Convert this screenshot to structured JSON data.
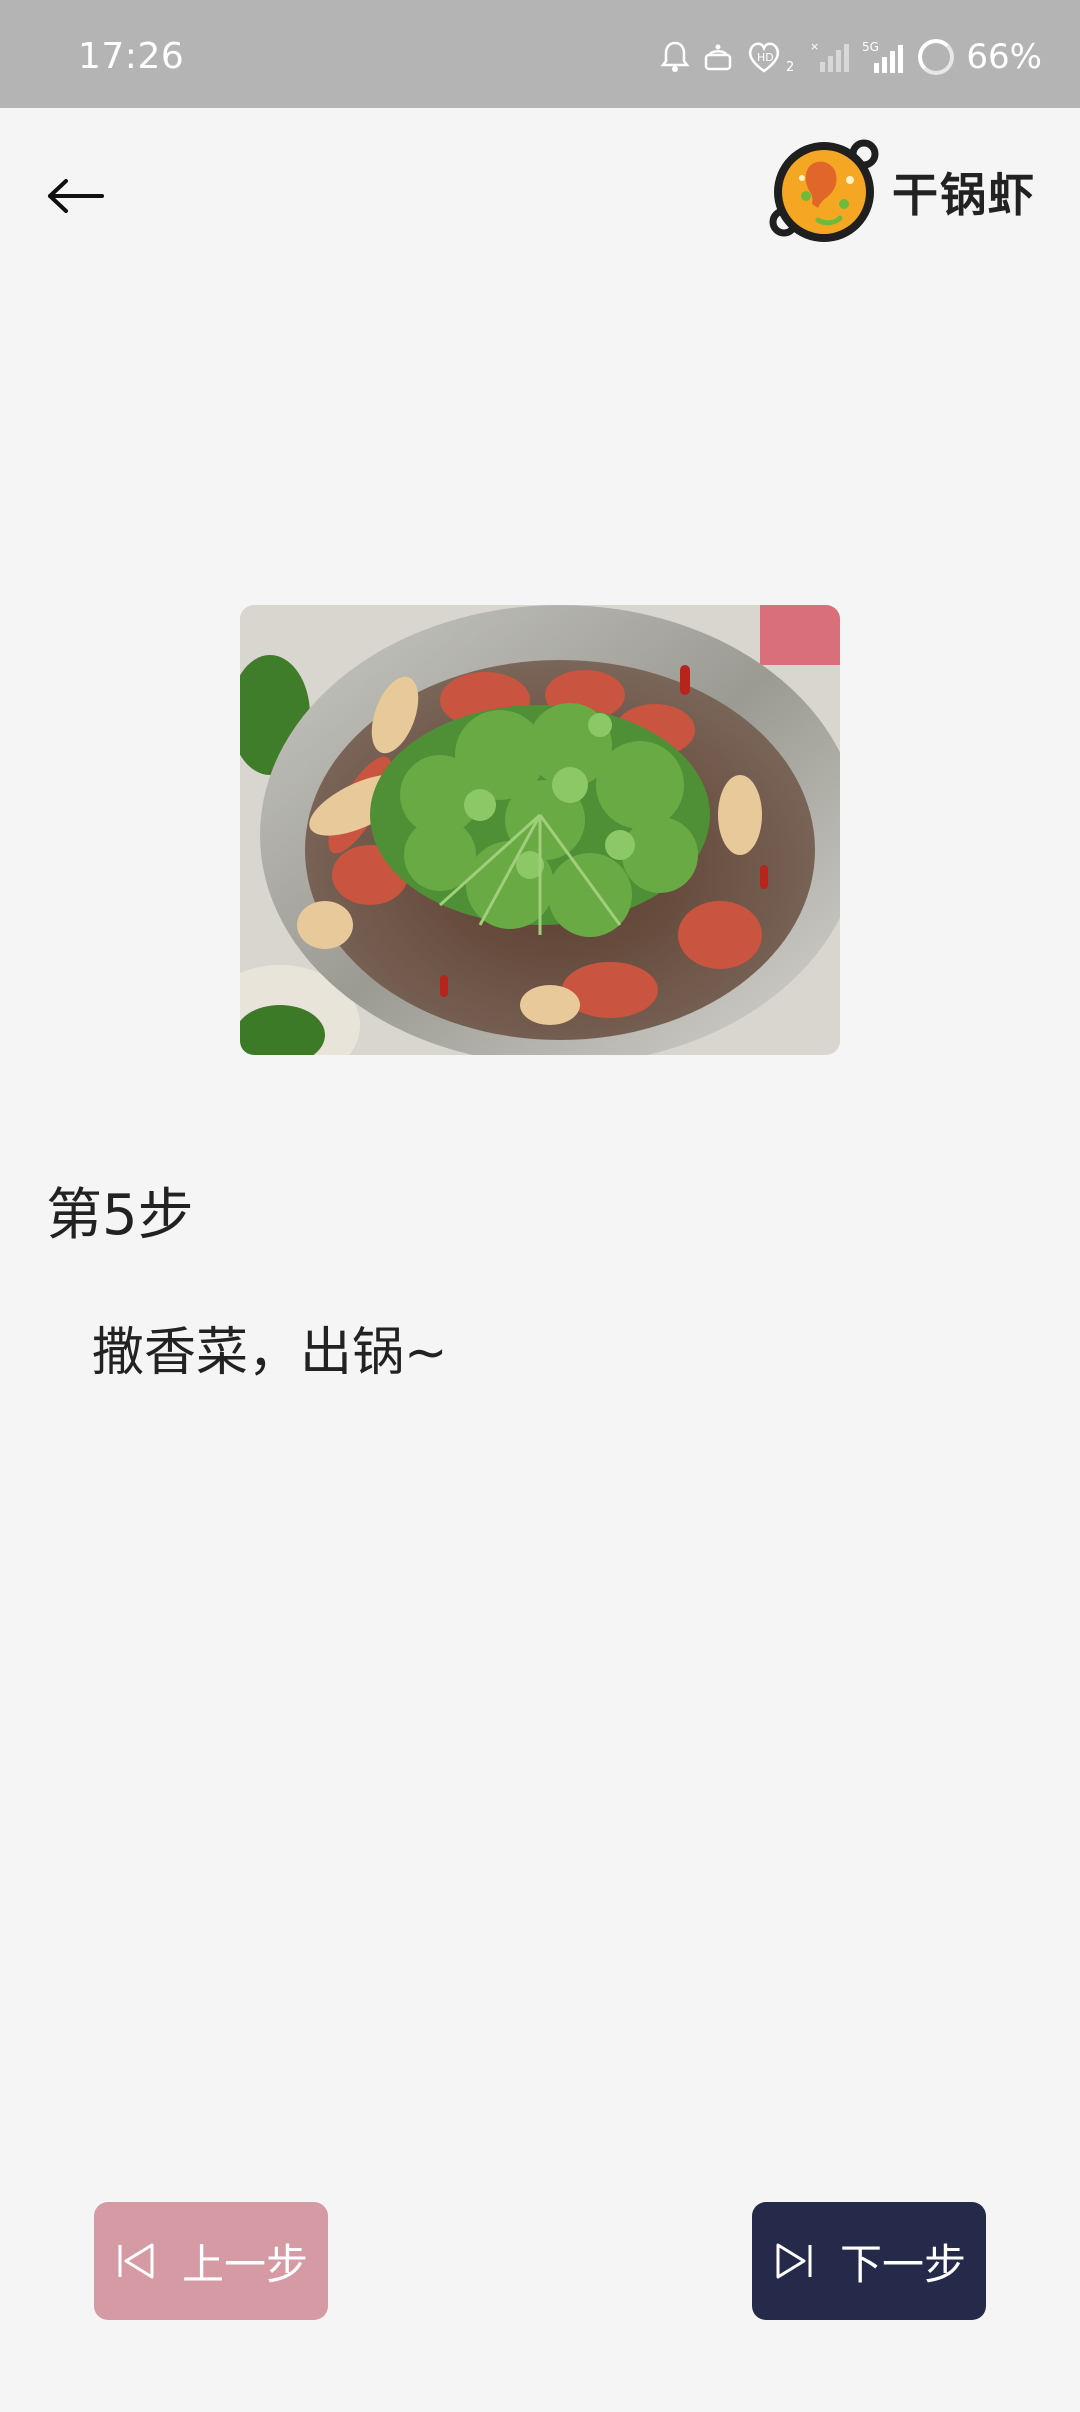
{
  "status_bar": {
    "time": "17:26",
    "battery": "66%",
    "icons": [
      "notification-bell-icon",
      "cake-icon",
      "hd-heart-icon",
      "signal-icon",
      "5g-signal-icon",
      "battery-ring-icon"
    ],
    "network_label": "5G"
  },
  "header": {
    "app_title": "干锅虾",
    "back_icon": "arrow-left-icon",
    "logo_icon": "paella-pan-logo"
  },
  "step": {
    "title": "第5步",
    "description": "撒香菜，出锅~"
  },
  "nav": {
    "prev_label": "上一步",
    "next_label": "下一步",
    "prev_color": "#d59aa4",
    "next_color": "#262a4a"
  }
}
